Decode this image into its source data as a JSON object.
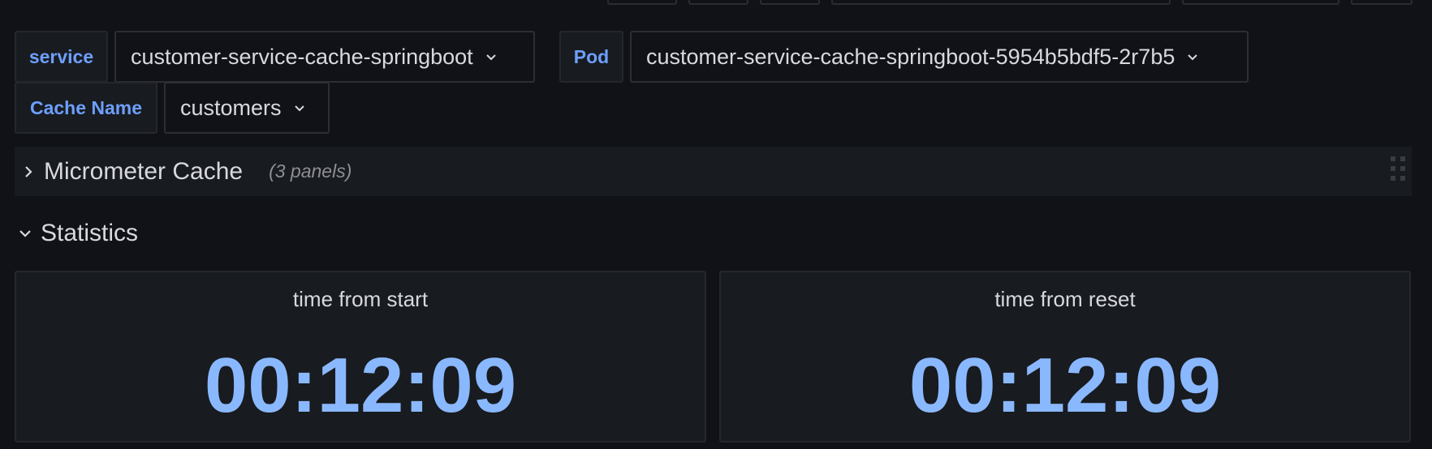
{
  "variables": {
    "service": {
      "label": "service",
      "value": "customer-service-cache-springboot"
    },
    "pod": {
      "label": "Pod",
      "value": "customer-service-cache-springboot-5954b5bdf5-2r7b5"
    },
    "cache_name": {
      "label": "Cache Name",
      "value": "customers"
    }
  },
  "rows": {
    "micrometer": {
      "title": "Micrometer Cache",
      "count": "(3 panels)",
      "collapsed": true
    },
    "statistics": {
      "title": "Statistics",
      "collapsed": false
    }
  },
  "panels": [
    {
      "title": "time from start",
      "value": "00:12:09"
    },
    {
      "title": "time from reset",
      "value": "00:12:09"
    }
  ],
  "colors": {
    "background": "#111217",
    "panel": "#181b1f",
    "label_accent": "#6e9fff",
    "stat_value": "#8ab8ff"
  },
  "icons": {
    "dropdown": "chevron-down-icon",
    "row_collapsed": "chevron-right-icon",
    "row_expanded": "chevron-down-icon",
    "drag": "drag-handle-icon"
  }
}
